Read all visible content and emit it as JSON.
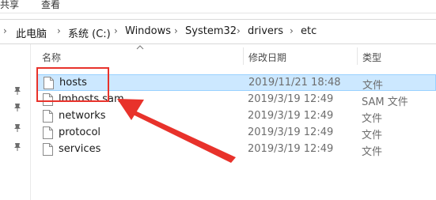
{
  "ribbon": {
    "tabs": [
      "共享",
      "查看"
    ]
  },
  "address_bar": {
    "crumbs": [
      "此电脑",
      "系统 (C:)",
      "Windows",
      "System32",
      "drivers",
      "etc"
    ]
  },
  "columns": {
    "name": "名称",
    "date_modified": "修改日期",
    "type": "类型"
  },
  "files": [
    {
      "name": "hosts",
      "date": "2019/11/21 18:48",
      "type": "文件"
    },
    {
      "name": "lmhosts.sam",
      "date": "2019/3/19 12:49",
      "type": "SAM 文件"
    },
    {
      "name": "networks",
      "date": "2019/3/19 12:49",
      "type": "文件"
    },
    {
      "name": "protocol",
      "date": "2019/3/19 12:49",
      "type": "文件"
    },
    {
      "name": "services",
      "date": "2019/3/19 12:49",
      "type": "文件"
    }
  ],
  "colors": {
    "selection": "#cce8ff",
    "selection_border": "#99d1ff",
    "annotation": "#e8322b"
  }
}
